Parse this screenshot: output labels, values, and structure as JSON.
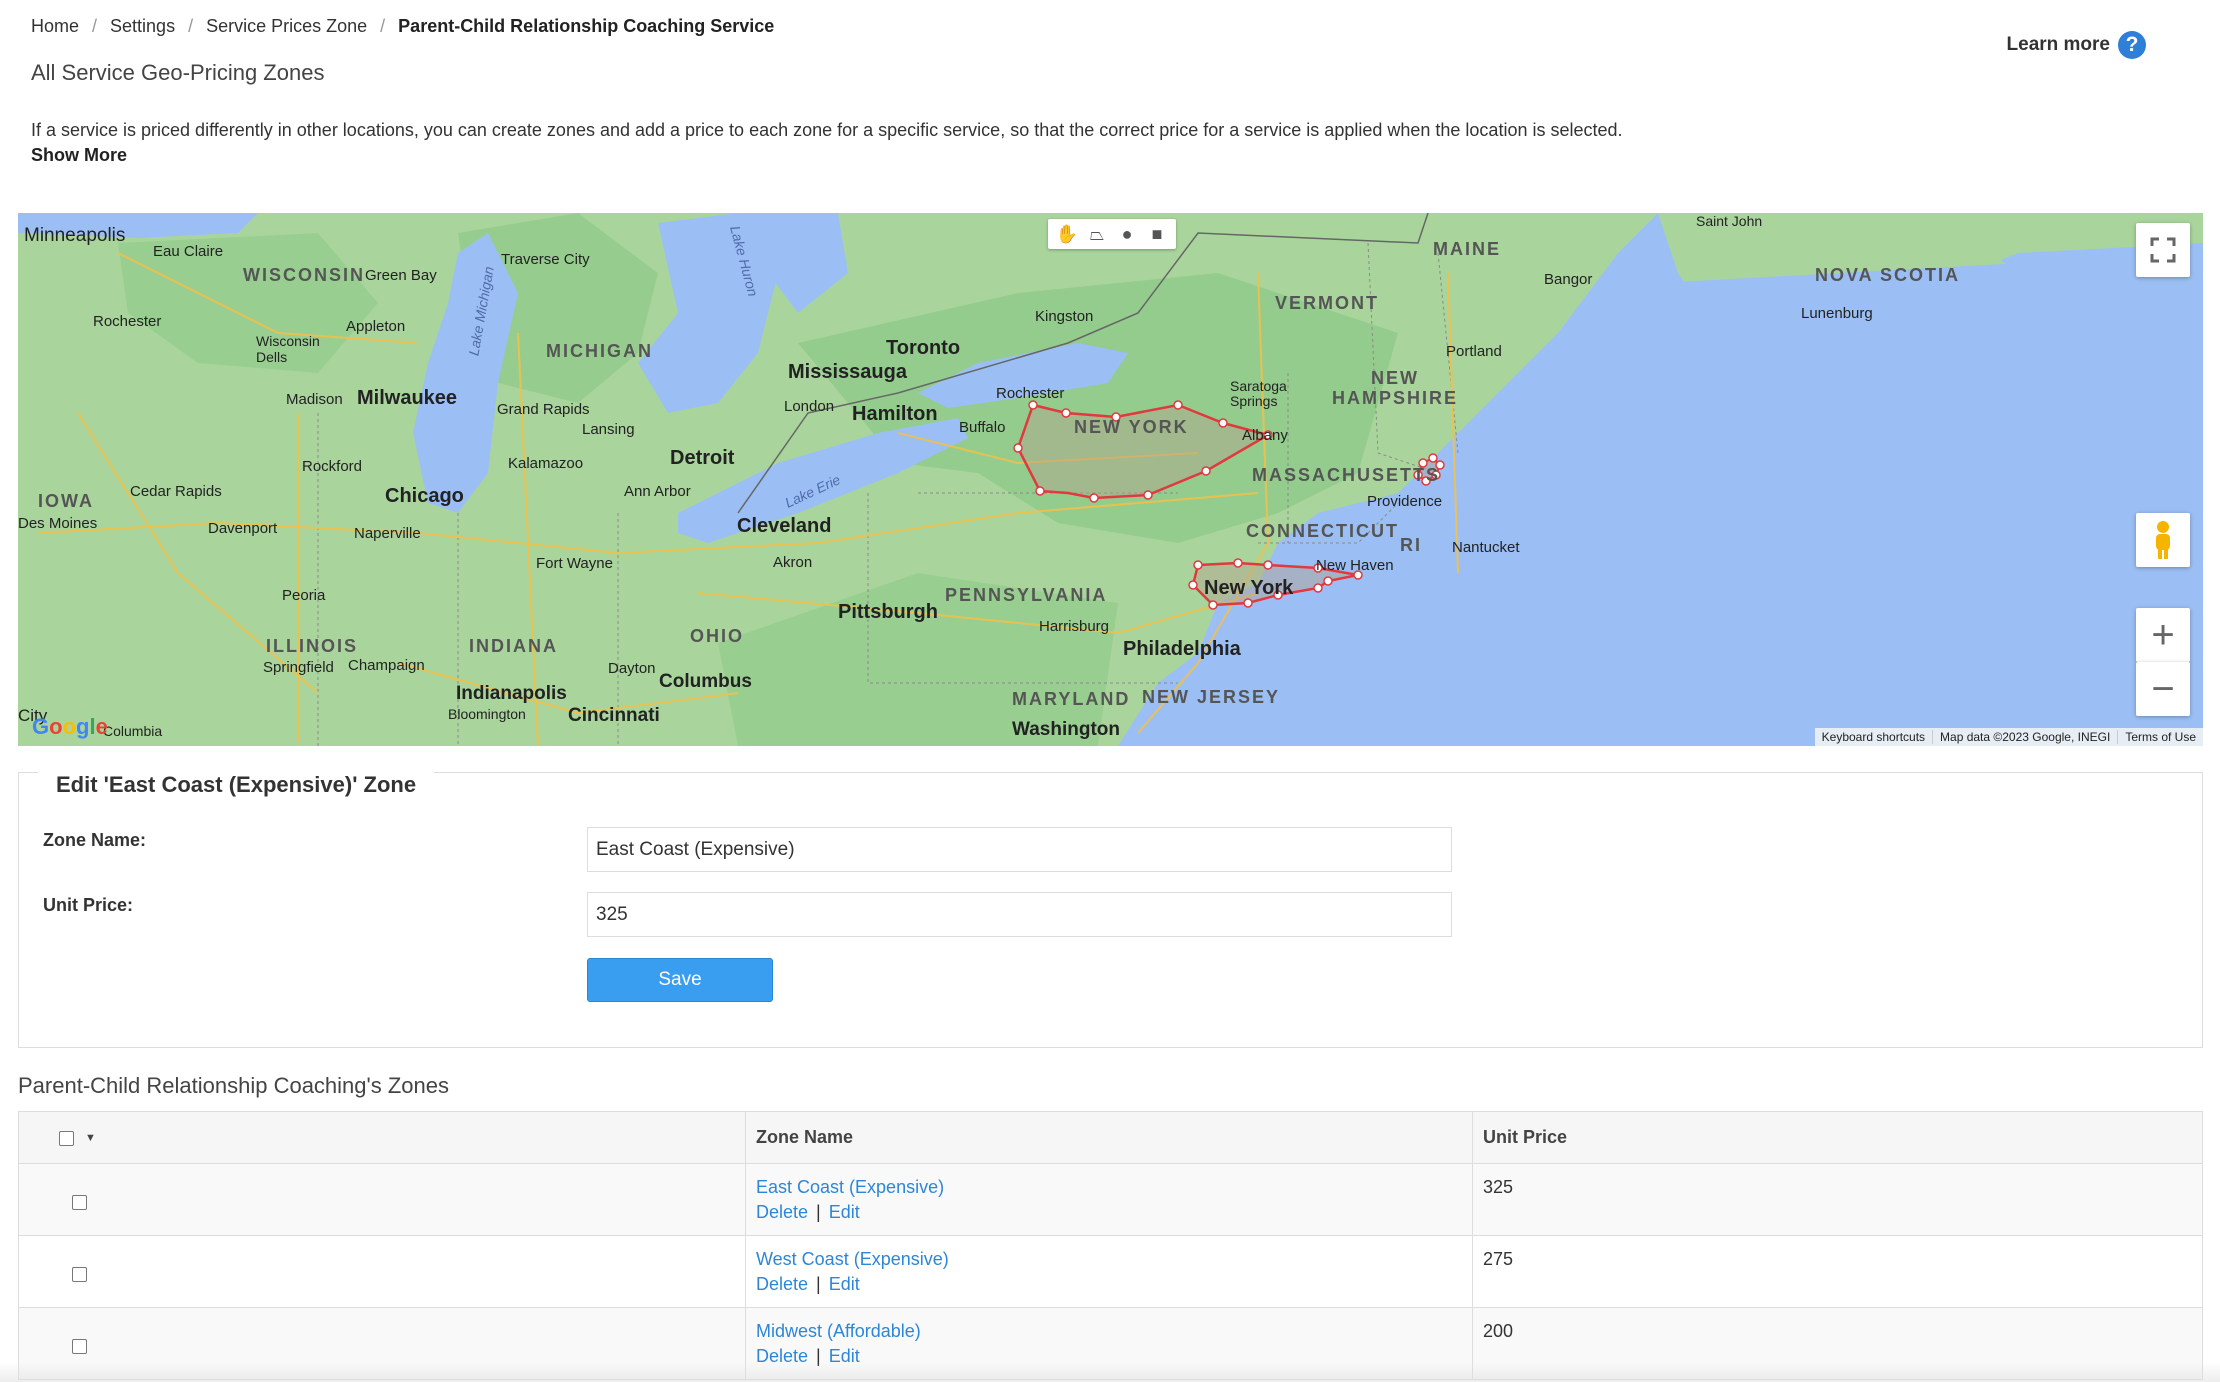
{
  "breadcrumb": {
    "items": [
      "Home",
      "Settings",
      "Service Prices Zone"
    ],
    "current": "Parent-Child Relationship Coaching Service"
  },
  "header": {
    "title": "All Service Geo-Pricing Zones",
    "learn_more": "Learn more",
    "help_icon": "?"
  },
  "intro": {
    "text": "If a service is priced differently in other locations, you can create zones and add a price to each zone for a specific service, so that the correct price for a service is applied when the location is selected.",
    "show_more": "Show More"
  },
  "map": {
    "labels": {
      "minneapolis": "Minneapolis",
      "eau_claire": "Eau Claire",
      "wisconsin": "WISCONSIN",
      "green_bay": "Green Bay",
      "traverse_city": "Traverse City",
      "rochester_mn": "Rochester",
      "appleton": "Appleton",
      "wisconsin_dells": "Wisconsin\nDells",
      "michigan": "MICHIGAN",
      "madison": "Madison",
      "milwaukee": "Milwaukee",
      "grand_rapids": "Grand Rapids",
      "lansing": "Lansing",
      "rockford": "Rockford",
      "kalamazoo": "Kalamazoo",
      "detroit": "Detroit",
      "ann_arbor": "Ann Arbor",
      "iowa": "IOWA",
      "des_moines": "Des Moines",
      "cedar_rapids": "Cedar Rapids",
      "chicago": "Chicago",
      "davenport": "Davenport",
      "naperville": "Naperville",
      "peoria": "Peoria",
      "illinois": "ILLINOIS",
      "springfield": "Springfield",
      "champaign": "Champaign",
      "indiana": "INDIANA",
      "indianapolis": "Indianapolis",
      "bloomington": "Bloomington",
      "fort_wayne": "Fort Wayne",
      "ohio": "OHIO",
      "dayton": "Dayton",
      "columbus": "Columbus",
      "cincinnati": "Cincinnati",
      "columbia": "Columbia",
      "toronto": "Toronto",
      "mississauga": "Mississauga",
      "hamilton": "Hamilton",
      "london": "London",
      "buffalo": "Buffalo",
      "cleveland": "Cleveland",
      "akron": "Akron",
      "pittsburgh": "Pittsburgh",
      "pennsylvania": "PENNSYLVANIA",
      "harrisburg": "Harrisburg",
      "philadelphia": "Philadelphia",
      "maryland": "MARYLAND",
      "new_jersey": "NEW JERSEY",
      "washington": "Washington",
      "kingston": "Kingston",
      "rochester_ny": "Rochester",
      "new_york_state": "NEW YORK",
      "albany": "Albany",
      "saratoga": "Saratoga\nSprings",
      "vermont": "VERMONT",
      "new_hampshire": "NEW\nHAMPSHIRE",
      "maine": "MAINE",
      "bangor": "Bangor",
      "portland": "Portland",
      "massachusetts": "MASSACHUSETTS",
      "providence": "Providence",
      "connecticut": "CONNECTICUT",
      "ri": "RI",
      "new_haven": "New Haven",
      "new_york_city": "New York",
      "nantucket": "Nantucket",
      "nova_scotia": "NOVA SCOTIA",
      "lunenburg": "Lunenburg",
      "saint_john": "Saint John",
      "lake_michigan": "Lake Michigan",
      "lake_huron": "Lake Huron",
      "lake_erie": "Lake Erie",
      "city": "City"
    },
    "attribution": [
      "Keyboard shortcuts",
      "Map data ©2023 Google, INEGI",
      "Terms of Use"
    ],
    "logo": "Google",
    "zones_shown": 3
  },
  "edit_form": {
    "legend": "Edit 'East Coast (Expensive)' Zone",
    "zone_name_label": "Zone Name:",
    "zone_name_value": "East Coast (Expensive)",
    "unit_price_label": "Unit Price:",
    "unit_price_value": "325",
    "save_label": "Save"
  },
  "zones_table": {
    "title": "Parent-Child Relationship Coaching's Zones",
    "columns": [
      "Zone Name",
      "Unit Price"
    ],
    "delete_label": "Delete",
    "edit_label": "Edit",
    "rows": [
      {
        "name": "East Coast (Expensive)",
        "price": "325"
      },
      {
        "name": "West Coast (Expensive)",
        "price": "275"
      },
      {
        "name": "Midwest (Affordable)",
        "price": "200"
      }
    ]
  },
  "colors": {
    "water": "#9bbff4",
    "land": "#a9d59c",
    "zone_stroke": "#e0393e",
    "link": "#2d86d7",
    "save_button": "#3a9ef0"
  }
}
